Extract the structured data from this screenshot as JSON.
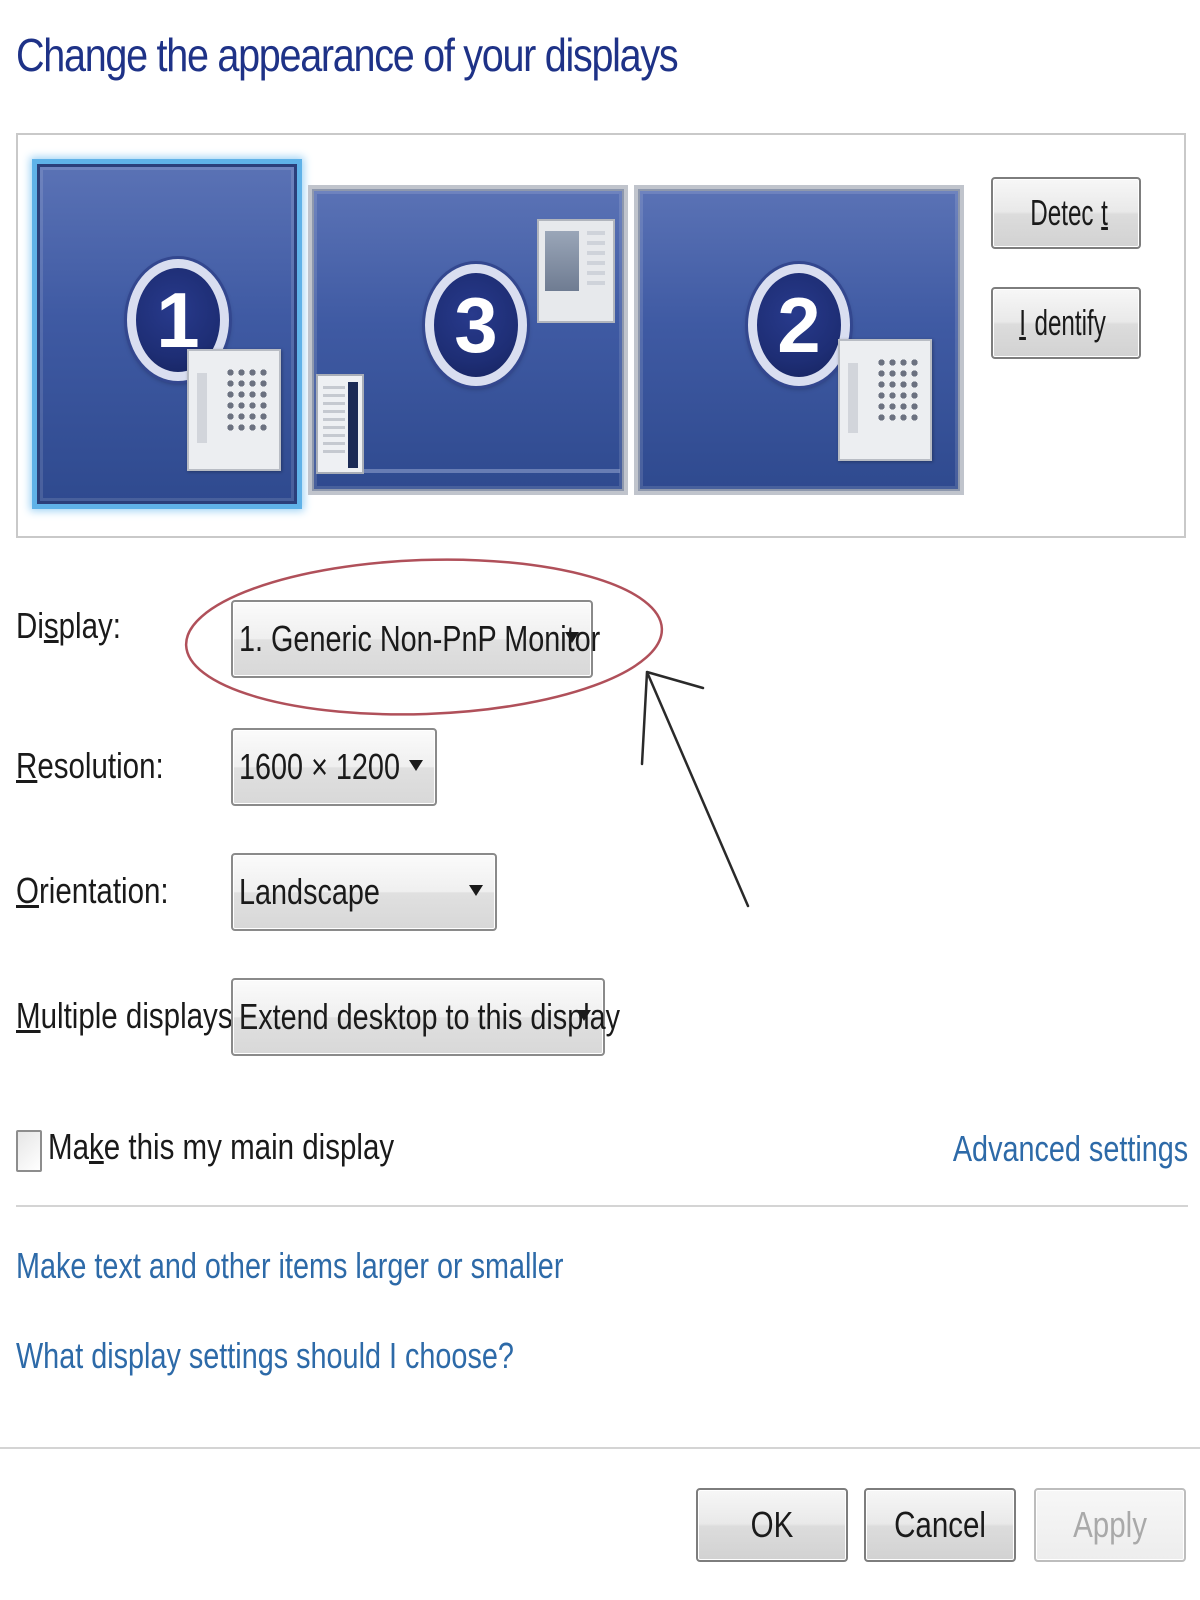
{
  "dialog": {
    "title": "Change the appearance of your displays"
  },
  "monitors": [
    {
      "number": "1",
      "selected": true
    },
    {
      "number": "3",
      "selected": false
    },
    {
      "number": "2",
      "selected": false
    }
  ],
  "buttons": {
    "detect": {
      "pre": "Detec",
      "key": "t",
      "post": ""
    },
    "identify": {
      "pre": "",
      "key": "I",
      "post": "dentify"
    },
    "ok": "OK",
    "cancel": "Cancel",
    "apply": "Apply"
  },
  "fields": {
    "display": {
      "label_pre": "Di",
      "label_key": "s",
      "label_post": "play:",
      "value": "1. Generic Non-PnP Monitor"
    },
    "resolution": {
      "label_pre": "",
      "label_key": "R",
      "label_post": "esolution:",
      "value": "1600 × 1200"
    },
    "orientation": {
      "label_pre": "",
      "label_key": "O",
      "label_post": "rientation:",
      "value": "Landscape"
    },
    "multiple": {
      "label_pre": "",
      "label_key": "M",
      "label_post": "ultiple displays:",
      "value": "Extend desktop to this display"
    }
  },
  "main_display": {
    "label_pre": "Ma",
    "label_key": "k",
    "label_post": "e this my main display",
    "checked": false
  },
  "links": {
    "advanced": "Advanced settings",
    "text_size": "Make text and other items larger or smaller",
    "help": "What display settings should I choose?"
  },
  "colors": {
    "title": "#1e3287",
    "link": "#2d6aa8",
    "selection": "#5fb2e8",
    "annotation": "#b0505a"
  }
}
